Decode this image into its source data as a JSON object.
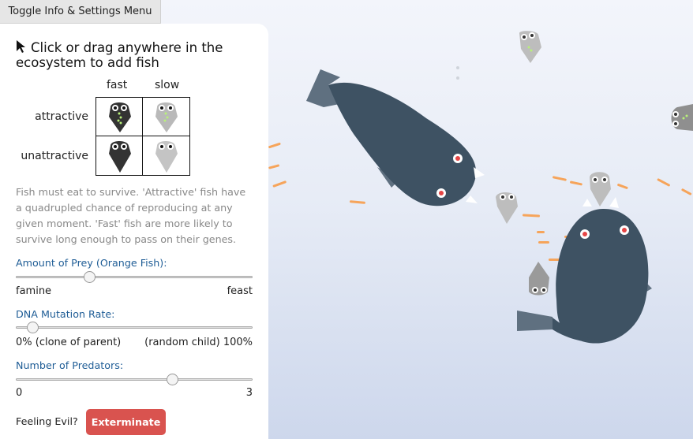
{
  "toggle_button": {
    "label": "Toggle Info & Settings Menu"
  },
  "panel": {
    "title": "Click or drag anywhere in the ecosystem to add fish",
    "cursor_icon": "cursor-arrow-icon",
    "legend": {
      "columns": [
        "fast",
        "slow"
      ],
      "rows": [
        "attractive",
        "unattractive"
      ]
    },
    "description": "Fish must eat to survive. 'Attractive' fish have a quadrupled chance of reproducing at any given moment. 'Fast' fish are more likely to survive long enough to pass on their genes.",
    "sliders": [
      {
        "label": "Amount of Prey (Orange Fish):",
        "min_label": "famine",
        "max_label": "feast",
        "value_fraction": 0.31
      },
      {
        "label": "DNA Mutation Rate:",
        "min_label": "0% (clone of parent)",
        "max_label": "(random child) 100%",
        "value_fraction": 0.07
      },
      {
        "label": "Number of Predators:",
        "min_label": "0",
        "max_label": "3",
        "value_fraction": 0.66
      }
    ],
    "evil": {
      "label": "Feeling Evil?",
      "button": "Exterminate"
    }
  },
  "colors": {
    "predator": "#3e5263",
    "predator_fin": "#5f7080",
    "prey": "#f6a45a",
    "fast_fish": "#333333",
    "slow_fish": "#b9b9b9",
    "attractive_marks": "#b8f07a",
    "exterminate": "#d9534f",
    "slider_label": "#1f5d96"
  }
}
